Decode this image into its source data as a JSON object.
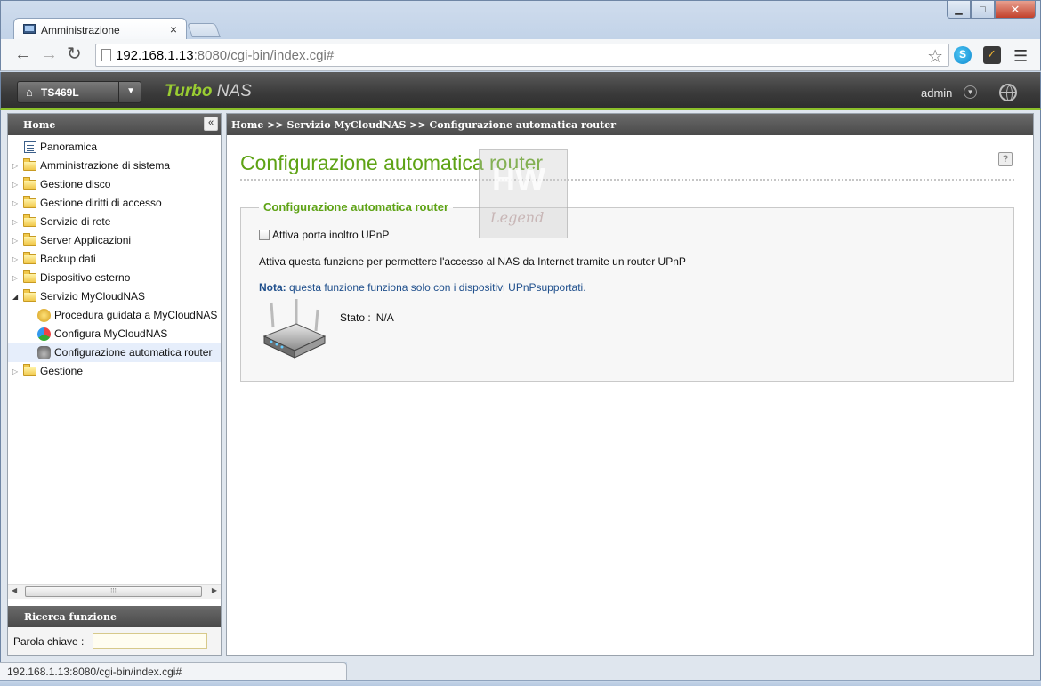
{
  "browser": {
    "tab_title": "Amministrazione",
    "tab_close": "×",
    "url_host": "192.168.1.13",
    "url_rest": ":8080/cgi-bin/index.cgi#",
    "status_url": "192.168.1.13:8080/cgi-bin/index.cgi#"
  },
  "nas": {
    "device_name": "TS469L",
    "brand_turbo": "Turbo",
    "brand_nas": "NAS",
    "user": "admin"
  },
  "sidebar": {
    "title": "Home",
    "items": [
      {
        "label": "Panoramica",
        "type": "panel"
      },
      {
        "label": "Amministrazione di sistema",
        "type": "folder"
      },
      {
        "label": "Gestione disco",
        "type": "folder"
      },
      {
        "label": "Gestione diritti di accesso",
        "type": "folder"
      },
      {
        "label": "Servizio di rete",
        "type": "folder"
      },
      {
        "label": "Server Applicazioni",
        "type": "folder"
      },
      {
        "label": "Backup dati",
        "type": "folder"
      },
      {
        "label": "Dispositivo esterno",
        "type": "folder"
      },
      {
        "label": "Servizio MyCloudNAS",
        "type": "folder",
        "expanded": true
      },
      {
        "label": "Procedura guidata a MyCloudNAS",
        "type": "child"
      },
      {
        "label": "Configura MyCloudNAS",
        "type": "child"
      },
      {
        "label": "Configurazione automatica router",
        "type": "child",
        "selected": true
      },
      {
        "label": "Gestione",
        "type": "folder"
      }
    ],
    "search_title": "Ricerca funzione",
    "search_label": "Parola chiave :",
    "search_value": ""
  },
  "main": {
    "breadcrumb": "Home >> Servizio MyCloudNAS >> Configurazione automatica router",
    "page_title": "Configurazione automatica router",
    "section_title": "Configurazione automatica router",
    "checkbox_label": "Attiva porta inoltro UPnP",
    "checkbox_checked": false,
    "description": "Attiva questa funzione per permettere l'accesso al NAS da Internet tramite un router UPnP",
    "note_label": "Nota:",
    "note_text": " questa funzione funziona solo con i dispositivi UPnPsupportati.",
    "status_label": "Stato :",
    "status_value": "N/A"
  },
  "watermark": {
    "text": "Legend"
  },
  "colors": {
    "accent": "#5ea315",
    "header_bar": "#4a4a4a",
    "note_blue": "#1f4f8c"
  }
}
